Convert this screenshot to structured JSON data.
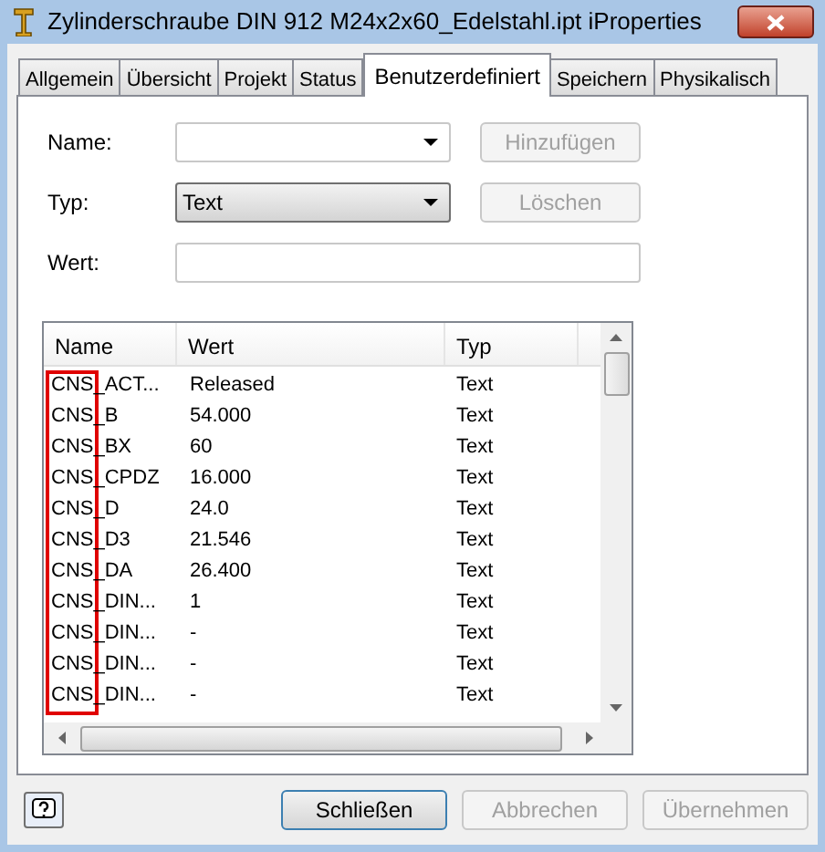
{
  "window": {
    "title": "Zylinderschraube DIN 912 M24x2x60_Edelstahl.ipt iProperties"
  },
  "tabs": [
    {
      "label": "Allgemein",
      "selected": false
    },
    {
      "label": "Übersicht",
      "selected": false
    },
    {
      "label": "Projekt",
      "selected": false
    },
    {
      "label": "Status",
      "selected": false
    },
    {
      "label": "Benutzerdefiniert",
      "selected": true
    },
    {
      "label": "Speichern",
      "selected": false
    },
    {
      "label": "Physikalisch",
      "selected": false
    }
  ],
  "form": {
    "name_label": "Name:",
    "type_label": "Typ:",
    "type_value": "Text",
    "value_label": "Wert:",
    "add_button": {
      "label": "Hinzufügen",
      "disabled": true
    },
    "delete_button": {
      "label": "Löschen",
      "disabled": true
    }
  },
  "table": {
    "columns": [
      "Name",
      "Wert",
      "Typ"
    ],
    "rows": [
      {
        "name": "CNS_ACT...",
        "value": "Released",
        "type": "Text"
      },
      {
        "name": "CNS_B",
        "value": "54.000",
        "type": "Text"
      },
      {
        "name": "CNS_BX",
        "value": "60",
        "type": "Text"
      },
      {
        "name": "CNS_CPDZ",
        "value": "16.000",
        "type": "Text"
      },
      {
        "name": "CNS_D",
        "value": "24.0",
        "type": "Text"
      },
      {
        "name": "CNS_D3",
        "value": "21.546",
        "type": "Text"
      },
      {
        "name": "CNS_DA",
        "value": "26.400",
        "type": "Text"
      },
      {
        "name": "CNS_DIN...",
        "value": "1",
        "type": "Text"
      },
      {
        "name": "CNS_DIN...",
        "value": "-",
        "type": "Text"
      },
      {
        "name": "CNS_DIN...",
        "value": "-",
        "type": "Text"
      },
      {
        "name": "CNS_DIN...",
        "value": "-",
        "type": "Text"
      }
    ]
  },
  "buttons": [
    {
      "label": "Schließen",
      "disabled": false
    },
    {
      "label": "Abbrechen",
      "disabled": true
    },
    {
      "label": "Übernehmen",
      "disabled": true
    }
  ]
}
